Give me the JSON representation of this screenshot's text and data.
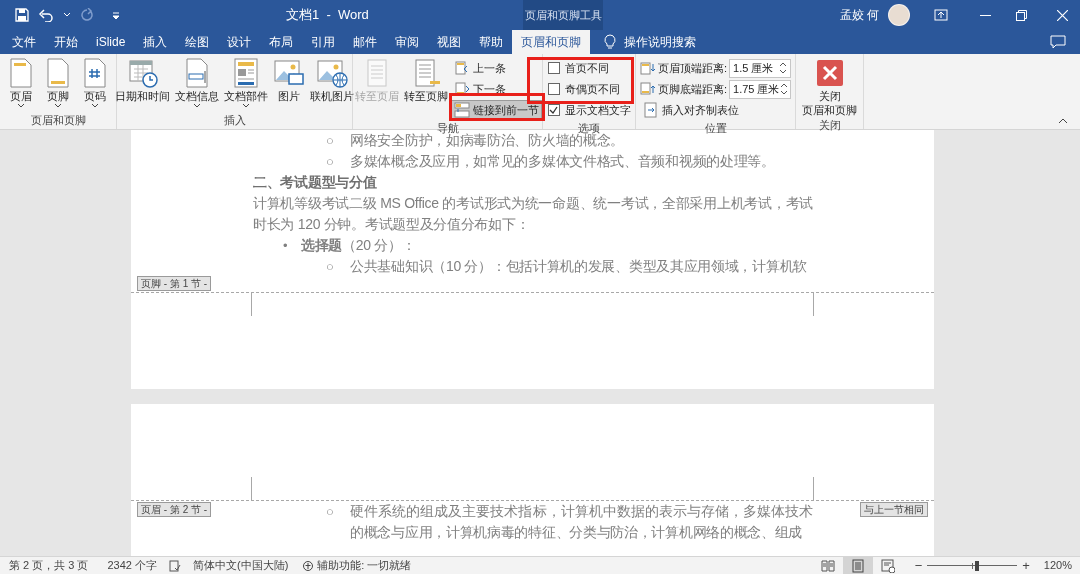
{
  "title_bar": {
    "document_title": "文档1  -  Word",
    "context_tools": "页眉和页脚工具",
    "user_name": "孟姣 何"
  },
  "tabs": [
    {
      "label": "文件",
      "selected": false
    },
    {
      "label": "开始",
      "selected": false
    },
    {
      "label": "iSlide",
      "selected": false
    },
    {
      "label": "插入",
      "selected": false
    },
    {
      "label": "绘图",
      "selected": false
    },
    {
      "label": "设计",
      "selected": false
    },
    {
      "label": "布局",
      "selected": false
    },
    {
      "label": "引用",
      "selected": false
    },
    {
      "label": "邮件",
      "selected": false
    },
    {
      "label": "审阅",
      "selected": false
    },
    {
      "label": "视图",
      "selected": false
    },
    {
      "label": "帮助",
      "selected": false
    },
    {
      "label": "页眉和页脚",
      "selected": true
    }
  ],
  "tell_me": "操作说明搜索",
  "ribbon": {
    "groups": [
      {
        "label": "页眉和页脚",
        "items": [
          {
            "kind": "large",
            "label": "页眉",
            "dropdown": true,
            "disabled": false
          },
          {
            "kind": "large",
            "label": "页脚",
            "dropdown": true,
            "disabled": false
          },
          {
            "kind": "large",
            "label": "页码",
            "dropdown": true,
            "disabled": false
          }
        ]
      },
      {
        "label": "插入",
        "items": [
          {
            "kind": "large",
            "label": "日期和时间",
            "dropdown": false,
            "disabled": false
          },
          {
            "kind": "large",
            "label": "文档信息",
            "dropdown": true,
            "disabled": false
          },
          {
            "kind": "large",
            "label": "文档部件",
            "dropdown": true,
            "disabled": false
          },
          {
            "kind": "large",
            "label": "图片",
            "dropdown": false,
            "disabled": false
          },
          {
            "kind": "large",
            "label": "联机图片",
            "dropdown": false,
            "disabled": false
          }
        ]
      },
      {
        "label": "导航",
        "items": [
          {
            "kind": "large",
            "label": "转至页眉",
            "dropdown": false,
            "disabled": true
          },
          {
            "kind": "large",
            "label": "转至页脚",
            "dropdown": false,
            "disabled": false
          },
          {
            "kind": "small",
            "label": "上一条",
            "selected": false
          },
          {
            "kind": "small",
            "label": "下一条",
            "selected": false
          },
          {
            "kind": "small",
            "label": "链接到前一节",
            "selected": true
          }
        ]
      },
      {
        "label": "选项",
        "items": [
          {
            "kind": "checkbox",
            "label": "首页不同",
            "checked": false
          },
          {
            "kind": "checkbox",
            "label": "奇偶页不同",
            "checked": false
          },
          {
            "kind": "checkbox",
            "label": "显示文档文字",
            "checked": true
          }
        ]
      },
      {
        "label": "位置",
        "items": [
          {
            "kind": "spin",
            "label": "页眉顶端距离:",
            "value": "1.5 厘米"
          },
          {
            "kind": "spin",
            "label": "页脚底端距离:",
            "value": "1.75 厘米"
          },
          {
            "kind": "small",
            "label": "插入对齐制表位",
            "selected": false
          }
        ]
      },
      {
        "label": "关闭",
        "items": [
          {
            "kind": "close",
            "label": [
              "关闭",
              "页眉和页脚"
            ],
            "dropdown": false,
            "disabled": false
          }
        ]
      }
    ]
  },
  "document": {
    "pages": [
      {
        "lines": [
          {
            "kind": "sub_bullet",
            "marker": "○",
            "text": "网络安全防护，如病毒防治、防火墙的概念。"
          },
          {
            "kind": "sub_bullet",
            "marker": "○",
            "text": "多媒体概念及应用，如常见的多媒体文件格式、音频和视频的处理等。"
          },
          {
            "kind": "heading",
            "text": "二、考试题型与分值"
          },
          {
            "kind": "body",
            "text": "计算机等级考试二级 MS Office 的考试形式为统一命题、统一考试，全部采用上机考试，考试时长为 120 分钟。考试题型及分值分布如下："
          },
          {
            "kind": "bullet",
            "marker": "•",
            "text": "**选择题**（20 分）："
          },
          {
            "kind": "sub_bullet",
            "marker": "○",
            "text": "公共基础知识（10 分）：包括计算机的发展、类型及其应用领域，计算机软"
          }
        ],
        "footer_tag": "页脚 - 第 1 节 -"
      },
      {
        "header_tag": "页眉 - 第 2 节 -",
        "same_as_previous": "与上一节相同",
        "lines": [
          {
            "kind": "sub_bullet",
            "marker": "○",
            "text": "硬件系统的组成及主要技术指标，计算机中数据的表示与存储，多媒体技术的概念与应用，计算机病毒的特征、分类与防治，计算机网络的概念、组成"
          }
        ]
      }
    ]
  },
  "status_bar": {
    "page": "第 2 页，共 3 页",
    "words": "2342 个字",
    "language": "简体中文(中国大陆)",
    "accessibility": "辅助功能: 一切就绪",
    "views": [
      {
        "selected": false
      },
      {
        "selected": true
      },
      {
        "selected": false
      }
    ],
    "zoom_out": "−",
    "zoom_in": "+",
    "zoom": {
      "level": 0.55,
      "reading": "120%"
    }
  }
}
